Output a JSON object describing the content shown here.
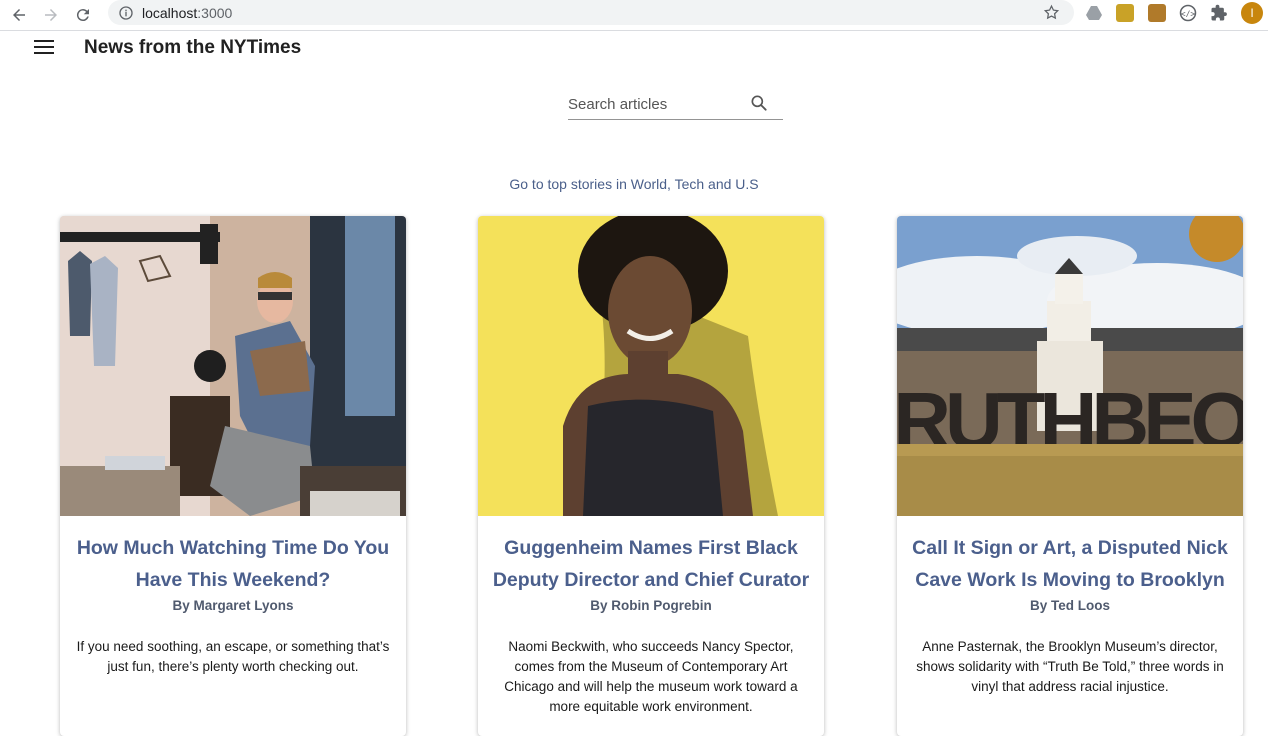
{
  "browser": {
    "url_host": "localhost",
    "url_port": ":3000",
    "avatar_initial": "I"
  },
  "app": {
    "title": "News from the NYTimes"
  },
  "search": {
    "placeholder": "Search articles"
  },
  "top_stories_link": "Go to top stories in World, Tech and U.S",
  "colors": {
    "title_accent": "#4b5f8c",
    "link": "#4a5f8a",
    "card_yellow": "#f4e15a"
  },
  "articles": [
    {
      "title": "How Much Watching Time Do You Have This Weekend?",
      "byline": "By Margaret Lyons",
      "abstract": "If you need soothing, an escape, or something that’s just fun, there’s plenty worth checking out.",
      "image": "man-sitting-on-bed-photo"
    },
    {
      "title": "Guggenheim Names First Black Deputy Director and Chief Curator",
      "byline": "By Robin Pogrebin",
      "abstract": "Naomi Beckwith, who succeeds Nancy Spector, comes from the Museum of Contemporary Art Chicago and will help the museum work toward a more equitable work environment.",
      "image": "woman-portrait-yellow-background-photo"
    },
    {
      "title": "Call It Sign or Art, a Disputed Nick Cave Work Is Moving to Brooklyn",
      "byline": "By Ted Loos",
      "abstract": "Anne Pasternak, the Brooklyn Museum’s director, shows solidarity with “Truth Be Told,” three words in vinyl that address racial injustice.",
      "image": "building-with-vinyl-letters-photo"
    }
  ]
}
